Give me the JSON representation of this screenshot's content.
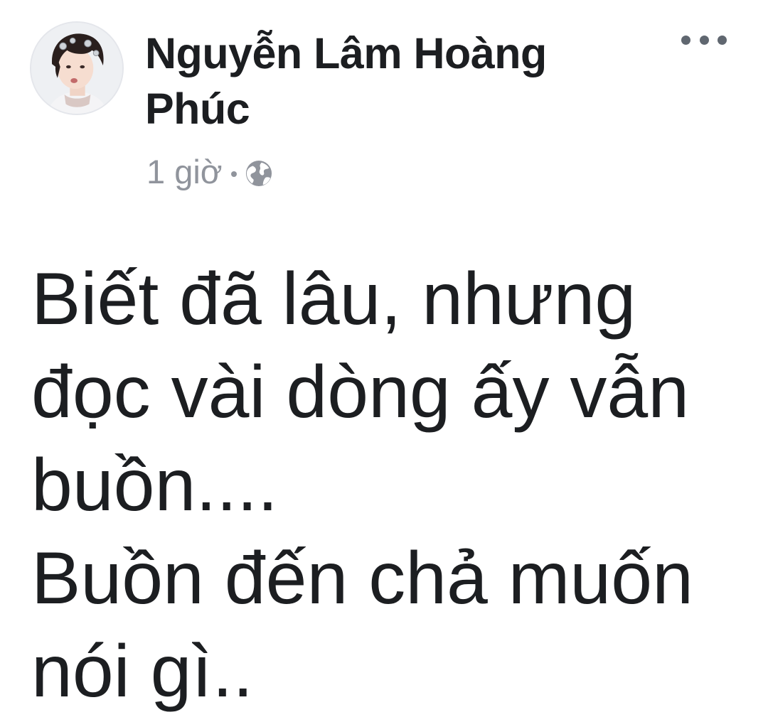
{
  "post": {
    "author": "Nguyễn Lâm Hoàng Phúc",
    "time": "1 giờ",
    "privacy_icon": "globe-icon",
    "more_icon": "more-horizontal-icon",
    "body": "Biết đã lâu, nhưng\nđọc vài dòng ấy vẫn\nbuồn....\nBuồn đến chả muốn\nnói gì.."
  },
  "colors": {
    "text": "#1c1e21",
    "meta": "#90949c",
    "icon": "#606770"
  }
}
